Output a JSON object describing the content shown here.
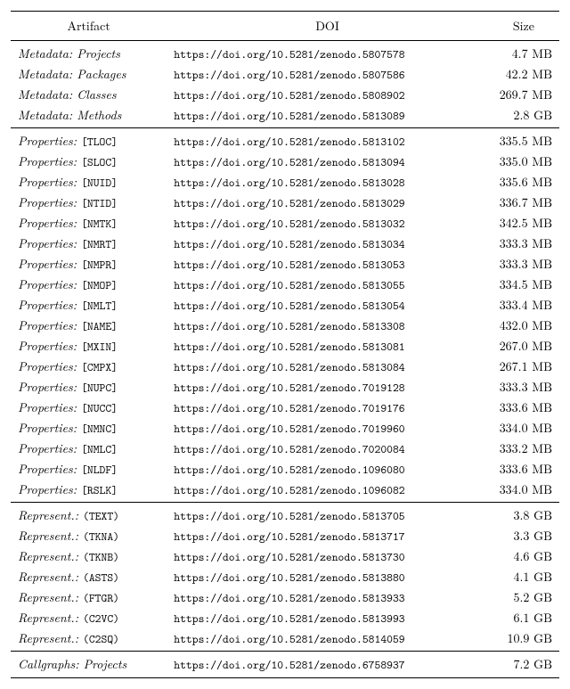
{
  "header": {
    "artifact": "Artifact",
    "doi": "DOI",
    "size": "Size"
  },
  "groups": [
    {
      "rows": [
        {
          "prefix": "Metadata:",
          "label": "Projects",
          "label_mono": false,
          "doi": "https://doi.org/10.5281/zenodo.5807578",
          "size": "4.7 MB"
        },
        {
          "prefix": "Metadata:",
          "label": "Packages",
          "label_mono": false,
          "doi": "https://doi.org/10.5281/zenodo.5807586",
          "size": "42.2 MB"
        },
        {
          "prefix": "Metadata:",
          "label": "Classes",
          "label_mono": false,
          "doi": "https://doi.org/10.5281/zenodo.5808902",
          "size": "269.7 MB"
        },
        {
          "prefix": "Metadata:",
          "label": "Methods",
          "label_mono": false,
          "doi": "https://doi.org/10.5281/zenodo.5813089",
          "size": "2.8 GB"
        }
      ]
    },
    {
      "rows": [
        {
          "prefix": "Properties:",
          "label": "[TLOC]",
          "label_mono": true,
          "doi": "https://doi.org/10.5281/zenodo.5813102",
          "size": "335.5 MB"
        },
        {
          "prefix": "Properties:",
          "label": "[SLOC]",
          "label_mono": true,
          "doi": "https://doi.org/10.5281/zenodo.5813094",
          "size": "335.0 MB"
        },
        {
          "prefix": "Properties:",
          "label": "[NUID]",
          "label_mono": true,
          "doi": "https://doi.org/10.5281/zenodo.5813028",
          "size": "335.6 MB"
        },
        {
          "prefix": "Properties:",
          "label": "[NTID]",
          "label_mono": true,
          "doi": "https://doi.org/10.5281/zenodo.5813029",
          "size": "336.7 MB"
        },
        {
          "prefix": "Properties:",
          "label": "[NMTK]",
          "label_mono": true,
          "doi": "https://doi.org/10.5281/zenodo.5813032",
          "size": "342.5 MB"
        },
        {
          "prefix": "Properties:",
          "label": "[NMRT]",
          "label_mono": true,
          "doi": "https://doi.org/10.5281/zenodo.5813034",
          "size": "333.3 MB"
        },
        {
          "prefix": "Properties:",
          "label": "[NMPR]",
          "label_mono": true,
          "doi": "https://doi.org/10.5281/zenodo.5813053",
          "size": "333.3 MB"
        },
        {
          "prefix": "Properties:",
          "label": "[NMOP]",
          "label_mono": true,
          "doi": "https://doi.org/10.5281/zenodo.5813055",
          "size": "334.5 MB"
        },
        {
          "prefix": "Properties:",
          "label": "[NMLT]",
          "label_mono": true,
          "doi": "https://doi.org/10.5281/zenodo.5813054",
          "size": "333.4 MB"
        },
        {
          "prefix": "Properties:",
          "label": "[NAME]",
          "label_mono": true,
          "doi": "https://doi.org/10.5281/zenodo.5813308",
          "size": "432.0 MB"
        },
        {
          "prefix": "Properties:",
          "label": "[MXIN]",
          "label_mono": true,
          "doi": "https://doi.org/10.5281/zenodo.5813081",
          "size": "267.0 MB"
        },
        {
          "prefix": "Properties:",
          "label": "[CMPX]",
          "label_mono": true,
          "doi": "https://doi.org/10.5281/zenodo.5813084",
          "size": "267.1 MB"
        },
        {
          "prefix": "Properties:",
          "label": "[NUPC]",
          "label_mono": true,
          "doi": "https://doi.org/10.5281/zenodo.7019128",
          "size": "333.3 MB"
        },
        {
          "prefix": "Properties:",
          "label": "[NUCC]",
          "label_mono": true,
          "doi": "https://doi.org/10.5281/zenodo.7019176",
          "size": "333.6 MB"
        },
        {
          "prefix": "Properties:",
          "label": "[NMNC]",
          "label_mono": true,
          "doi": "https://doi.org/10.5281/zenodo.7019960",
          "size": "334.0 MB"
        },
        {
          "prefix": "Properties:",
          "label": "[NMLC]",
          "label_mono": true,
          "doi": "https://doi.org/10.5281/zenodo.7020084",
          "size": "333.2 MB"
        },
        {
          "prefix": "Properties:",
          "label": "[NLDF]",
          "label_mono": true,
          "doi": "https://doi.org/10.5281/zenodo.1096080",
          "size": "333.6 MB"
        },
        {
          "prefix": "Properties:",
          "label": "[RSLK]",
          "label_mono": true,
          "doi": "https://doi.org/10.5281/zenodo.1096082",
          "size": "334.0 MB"
        }
      ]
    },
    {
      "rows": [
        {
          "prefix": "Represent.:",
          "label": "(TEXT)",
          "label_mono": true,
          "doi": "https://doi.org/10.5281/zenodo.5813705",
          "size": "3.8 GB"
        },
        {
          "prefix": "Represent.:",
          "label": "(TKNA)",
          "label_mono": true,
          "doi": "https://doi.org/10.5281/zenodo.5813717",
          "size": "3.3 GB"
        },
        {
          "prefix": "Represent.:",
          "label": "(TKNB)",
          "label_mono": true,
          "doi": "https://doi.org/10.5281/zenodo.5813730",
          "size": "4.6 GB"
        },
        {
          "prefix": "Represent.:",
          "label": "(ASTS)",
          "label_mono": true,
          "doi": "https://doi.org/10.5281/zenodo.5813880",
          "size": "4.1 GB"
        },
        {
          "prefix": "Represent.:",
          "label": "(FTGR)",
          "label_mono": true,
          "doi": "https://doi.org/10.5281/zenodo.5813933",
          "size": "5.2 GB"
        },
        {
          "prefix": "Represent.:",
          "label": "(C2VC)",
          "label_mono": true,
          "doi": "https://doi.org/10.5281/zenodo.5813993",
          "size": "6.1 GB"
        },
        {
          "prefix": "Represent.:",
          "label": "(C2SQ)",
          "label_mono": true,
          "doi": "https://doi.org/10.5281/zenodo.5814059",
          "size": "10.9 GB"
        }
      ]
    },
    {
      "rows": [
        {
          "prefix": "Callgraphs:",
          "label": "Projects",
          "label_mono": false,
          "doi": "https://doi.org/10.5281/zenodo.6758937",
          "size": "7.2 GB"
        }
      ]
    }
  ]
}
